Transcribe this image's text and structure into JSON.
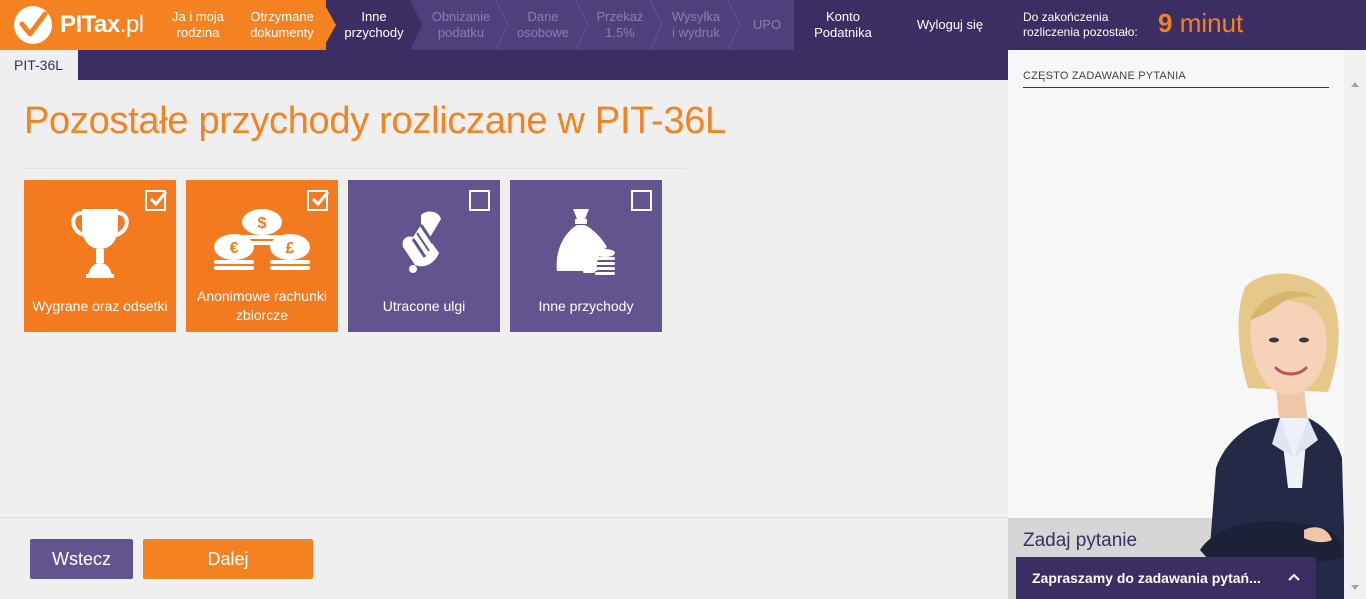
{
  "brand": {
    "logo_text_bold": "PITax",
    "logo_text_thin": ".pl"
  },
  "nav": {
    "steps": [
      {
        "label_1": "Ja i moja",
        "label_2": "rodzina",
        "state": "done"
      },
      {
        "label_1": "Otrzymane",
        "label_2": "dokumenty",
        "state": "done"
      },
      {
        "label_1": "Inne",
        "label_2": "przychody",
        "state": "current"
      },
      {
        "label_1": "Obniżanie",
        "label_2": "podatku",
        "state": "todo"
      },
      {
        "label_1": "Dane",
        "label_2": "osobowe",
        "state": "todo"
      },
      {
        "label_1": "Przekaż",
        "label_2": "1,5%",
        "state": "todo"
      },
      {
        "label_1": "Wysyłka",
        "label_2": "i wydruk",
        "state": "todo"
      },
      {
        "label_1": "UPO",
        "label_2": "",
        "state": "todo"
      }
    ],
    "account_1": "Konto",
    "account_2": "Podatnika",
    "logout": "Wyloguj się"
  },
  "timer": {
    "label_1": "Do zakończenia",
    "label_2": "rozliczenia pozostało:",
    "number": "9",
    "unit": "minut"
  },
  "form_tab": "PIT-36L",
  "page_title": "Pozostałe przychody rozliczane w PIT-36L",
  "tiles": [
    {
      "label": "Wygrane oraz odsetki",
      "checked": true,
      "icon": "trophy-icon"
    },
    {
      "label": "Anonimowe rachunki zbiorcze",
      "checked": true,
      "icon": "coins-icon"
    },
    {
      "label": "Utracone ulgi",
      "checked": false,
      "icon": "scroll-icon"
    },
    {
      "label": "Inne przychody",
      "checked": false,
      "icon": "money-bag-icon"
    }
  ],
  "buttons": {
    "back": "Wstecz",
    "next": "Dalej"
  },
  "sidebar": {
    "faq_title": "CZĘSTO ZADAWANE PYTANIA",
    "ask_title": "Zadaj pytanie",
    "chat_label": "Zapraszamy do zadawania pytań..."
  },
  "colors": {
    "orange": "#f58220",
    "purple_dark": "#3b2e63",
    "purple_tile": "#63548f"
  }
}
